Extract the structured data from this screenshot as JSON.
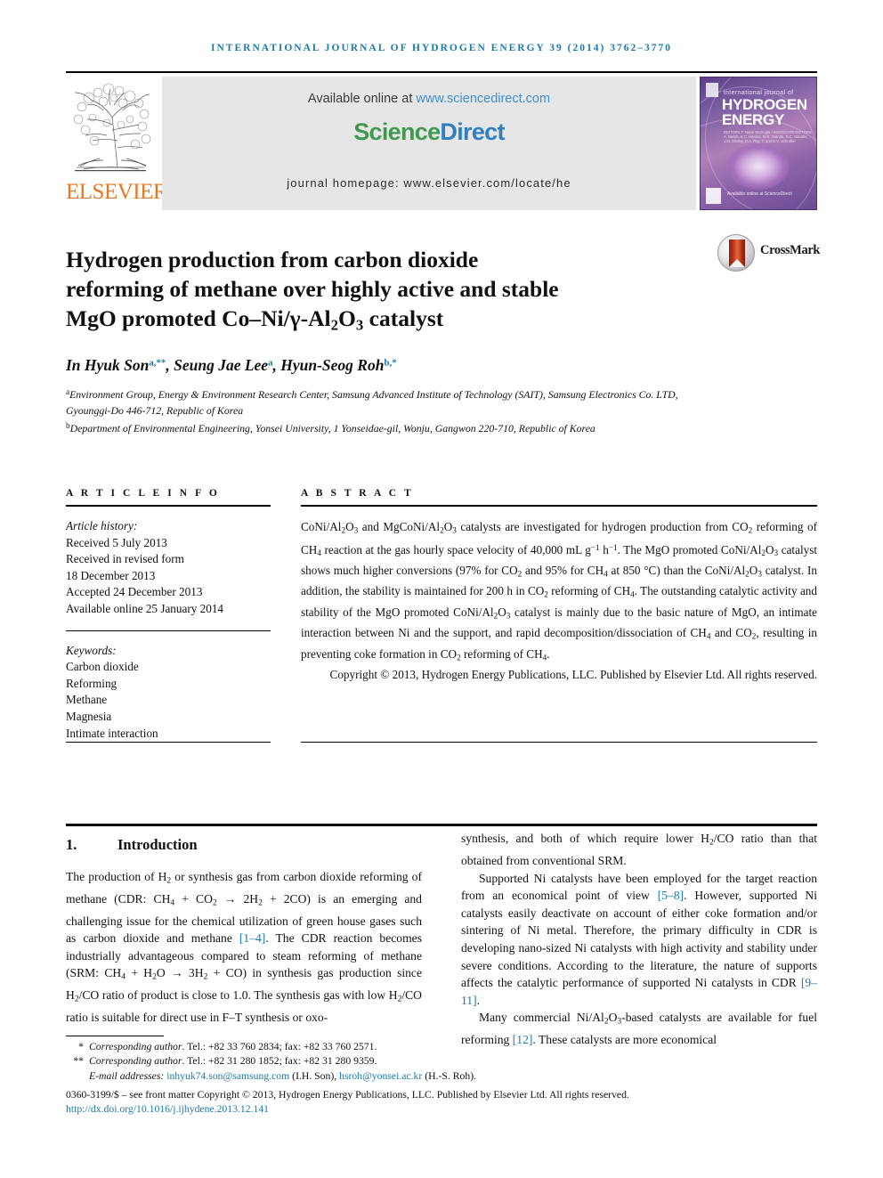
{
  "running_head": "International Journal of Hydrogen Energy 39 (2014) 3762–3770",
  "masthead": {
    "publisher_name": "ELSEVIER",
    "available_prefix": "Available online at ",
    "available_url": "www.sciencedirect.com",
    "sciencedirect_part1": "Science",
    "sciencedirect_part2": "Direct",
    "journal_homepage": "journal homepage: www.elsevier.com/locate/he",
    "cover": {
      "line1": "international journal of",
      "line2": "HYDROGEN",
      "line3": "ENERGY",
      "meta": "EDITORS  T. Nejat Veziroglu  /  ASSOCIATE EDITORS  A. Bielsh, K.C. Hanlon, M.R. Islanda, R.C. Nacobs, J.M. Shelby, D.A. Ray, T. and D.V. Schrafler",
      "sciencedirect_note": "Available online at\nScienceDirect"
    },
    "crossmark_label": "CrossMark"
  },
  "title": {
    "line1": "Hydrogen production from carbon dioxide",
    "line2": "reforming of methane over highly active and stable",
    "line3_a": "MgO promoted Co–Ni/γ-Al",
    "line3_sub1": "2",
    "line3_b": "O",
    "line3_sub2": "3",
    "line3_c": " catalyst"
  },
  "authors": {
    "a1_name": "In Hyuk Son",
    "a1_sup": "a,**",
    "sep1": ", ",
    "a2_name": "Seung Jae Lee",
    "a2_sup": "a",
    "sep2": ", ",
    "a3_name": "Hyun-Seog Roh",
    "a3_sup": "b,*"
  },
  "affiliations": {
    "a_sup": "a",
    "a_text": "Environment Group, Energy & Environment Research Center, Samsung Advanced Institute of Technology (SAIT), Samsung Electronics Co. LTD, Gyounggi-Do 446-712, Republic of Korea",
    "b_sup": "b",
    "b_text": "Department of Environmental Engineering, Yonsei University, 1 Yonseidae-gil, Wonju, Gangwon 220-710, Republic of Korea"
  },
  "article_info": {
    "heading": "A R T I C L E   I N F O",
    "history_label": "Article history:",
    "history": [
      "Received 5 July 2013",
      "Received in revised form",
      "18 December 2013",
      "Accepted 24 December 2013",
      "Available online 25 January 2014"
    ],
    "keywords_label": "Keywords:",
    "keywords": [
      "Carbon dioxide",
      "Reforming",
      "Methane",
      "Magnesia",
      "Intimate interaction"
    ]
  },
  "abstract": {
    "heading": "A B S T R A C T",
    "copyright": "Copyright © 2013, Hydrogen Energy Publications, LLC. Published by Elsevier Ltd. All rights reserved."
  },
  "introduction": {
    "number": "1.",
    "heading": "Introduction"
  },
  "footnotes": {
    "star1_mark": "*",
    "star1_label": "Corresponding author",
    "star1_text": ". Tel.: +82 33 760 2834; fax: +82 33 760 2571.",
    "star2_mark": "**",
    "star2_label": "Corresponding author",
    "star2_text": ". Tel.: +82 31 280 1852; fax: +82 31 280 9359.",
    "email_label": "E-mail addresses: ",
    "email1": "inhyuk74.son@samsung.com",
    "email1_who": " (I.H. Son), ",
    "email2": "hsroh@yonsei.ac.kr",
    "email2_who": " (H.-S. Roh).",
    "issn_line": "0360-3199/$ – see front matter Copyright © 2013, Hydrogen Energy Publications, LLC. Published by Elsevier Ltd. All rights reserved.",
    "doi": "http://dx.doi.org/10.1016/j.ijhydene.2013.12.141"
  },
  "colors": {
    "link": "#1a7aa8",
    "elsevier_orange": "#E87722",
    "sciencedirect_green": "#3f9a4e",
    "sciencedirect_blue": "#2f7fc1",
    "band_gray": "#e6e6e6"
  }
}
